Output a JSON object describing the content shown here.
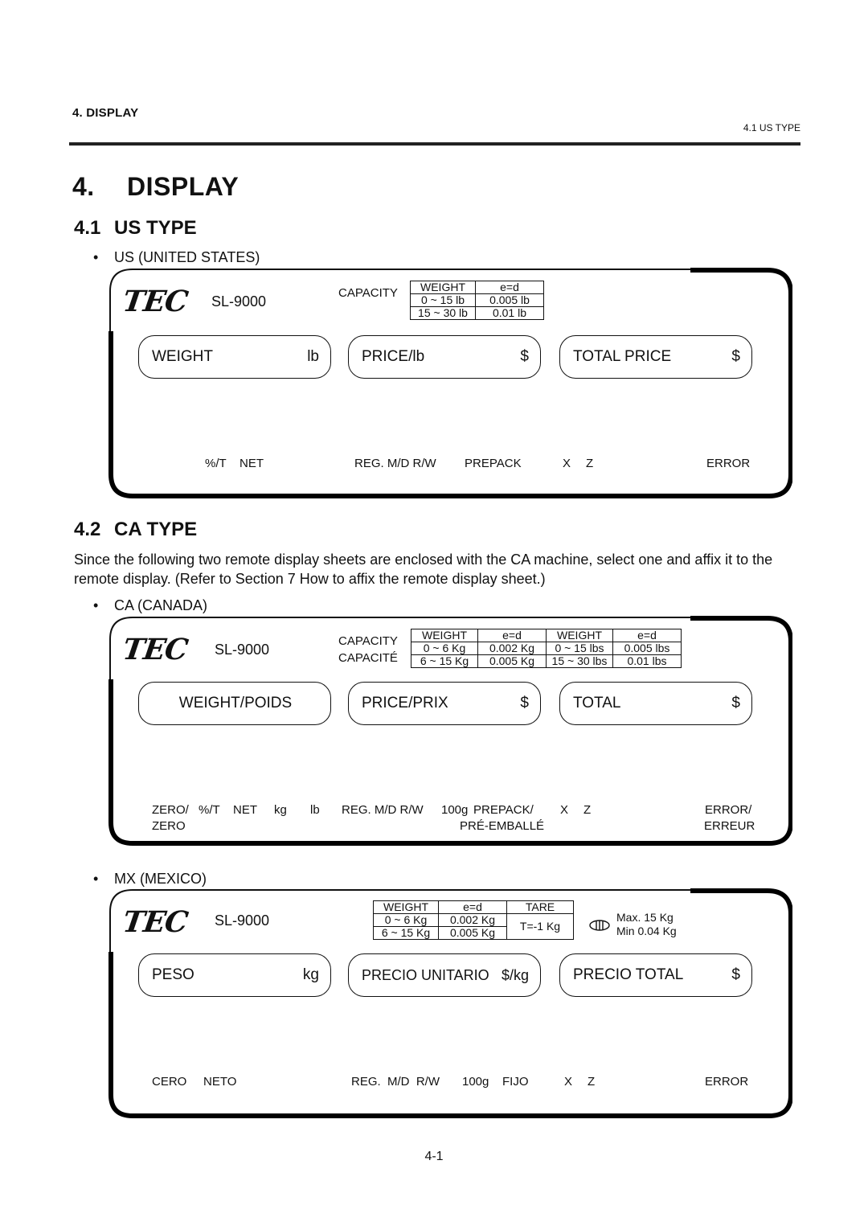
{
  "header": {
    "section": "4.   DISPLAY",
    "subsection": "4.1 US TYPE"
  },
  "title": {
    "number": "4.",
    "text": "DISPLAY"
  },
  "us_section": {
    "number": "4.1",
    "title": "US TYPE",
    "bullet": "US (UNITED STATES)",
    "panel": {
      "logo": "TEC",
      "model": "SL-9000",
      "capacity_label": "CAPACITY",
      "capacity_table": [
        [
          "WEIGHT",
          "e=d"
        ],
        [
          "0 ~ 15 lb",
          "0.005 lb"
        ],
        [
          "15 ~ 30 lb",
          "0.01 lb"
        ]
      ],
      "fields": [
        {
          "label": "WEIGHT",
          "unit": "lb"
        },
        {
          "label": "PRICE/lb",
          "unit": "$"
        },
        {
          "label": "TOTAL PRICE",
          "unit": "$"
        }
      ],
      "annunciators": [
        "%/T",
        "NET",
        "REG. M/D R/W",
        "PREPACK",
        "X",
        "Z",
        "ERROR"
      ]
    }
  },
  "ca_section": {
    "number": "4.2",
    "title": "CA TYPE",
    "paragraph": "Since the following two remote display sheets are enclosed with the CA machine, select one and affix it to the remote display.  (Refer to Section 7 How to affix the remote display sheet.)",
    "bullet": "CA (CANADA)",
    "panel": {
      "logo": "TEC",
      "model": "SL-9000",
      "capacity_label": "CAPACITY",
      "capacity_label_fr": "CAPACITÉ",
      "capacity_table": [
        [
          "WEIGHT",
          "e=d",
          "WEIGHT",
          "e=d"
        ],
        [
          "0 ~ 6 Kg",
          "0.002 Kg",
          "0 ~ 15 lbs",
          "0.005 lbs"
        ],
        [
          "6 ~ 15 Kg",
          "0.005 Kg",
          "15 ~ 30 lbs",
          "0.01 lbs"
        ]
      ],
      "fields": [
        {
          "label": "WEIGHT/POIDS",
          "unit": ""
        },
        {
          "label": "PRICE/PRIX",
          "unit": "$"
        },
        {
          "label": "TOTAL",
          "unit": "$"
        }
      ],
      "annunciators_row1": [
        "ZERO/",
        "%/T",
        "NET",
        "kg",
        "lb",
        "REG. M/D R/W",
        "100g",
        "PREPACK/",
        "X",
        "Z",
        "ERROR/"
      ],
      "annunciators_row2": [
        "ZERO",
        "PRÉ-EMBALLÉ",
        "ERREUR"
      ]
    }
  },
  "mx_section": {
    "bullet": "MX (MEXICO)",
    "panel": {
      "logo": "TEC",
      "model": "SL-9000",
      "capacity_table": {
        "headers": [
          "WEIGHT",
          "e=d",
          "TARE"
        ],
        "rows": [
          [
            "0 ~ 6 Kg",
            "0.002 Kg"
          ],
          [
            "6 ~ 15 Kg",
            "0.005 Kg"
          ]
        ],
        "tare": "T=-1 Kg"
      },
      "max": "Max. 15 Kg",
      "min": "Min 0.04 Kg",
      "fields": [
        {
          "label": "PESO",
          "unit": "kg"
        },
        {
          "label": "PRECIO UNITARIO",
          "unit": "$/kg"
        },
        {
          "label": "PRECIO TOTAL",
          "unit": "$"
        }
      ],
      "annunciators": [
        "CERO",
        "NETO",
        "REG.  M/D  R/W",
        "100g",
        "FIJO",
        "X",
        "Z",
        "ERROR"
      ]
    }
  },
  "page_number": "4-1"
}
